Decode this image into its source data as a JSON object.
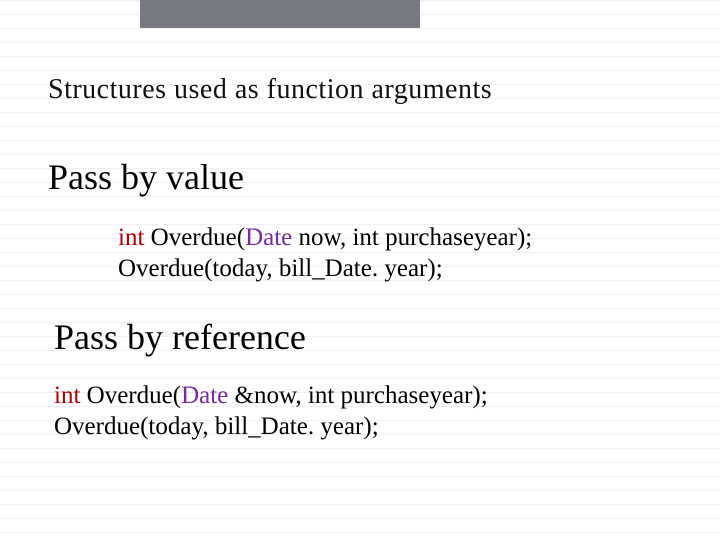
{
  "title": "Structures used as function arguments",
  "section1": {
    "heading": "Pass by value",
    "kw": "int",
    "fn1a": " Overdue(",
    "type": "Date",
    "fn1b": " now, int purchaseyear);",
    "line2": "Overdue(today, bill_Date. year);"
  },
  "section2": {
    "heading": "Pass by reference",
    "kw": "int",
    "fn1a": " Overdue(",
    "type": "Date",
    "fn1b": " &now, int purchaseyear);",
    "line2": "Overdue(today, bill_Date. year);"
  }
}
